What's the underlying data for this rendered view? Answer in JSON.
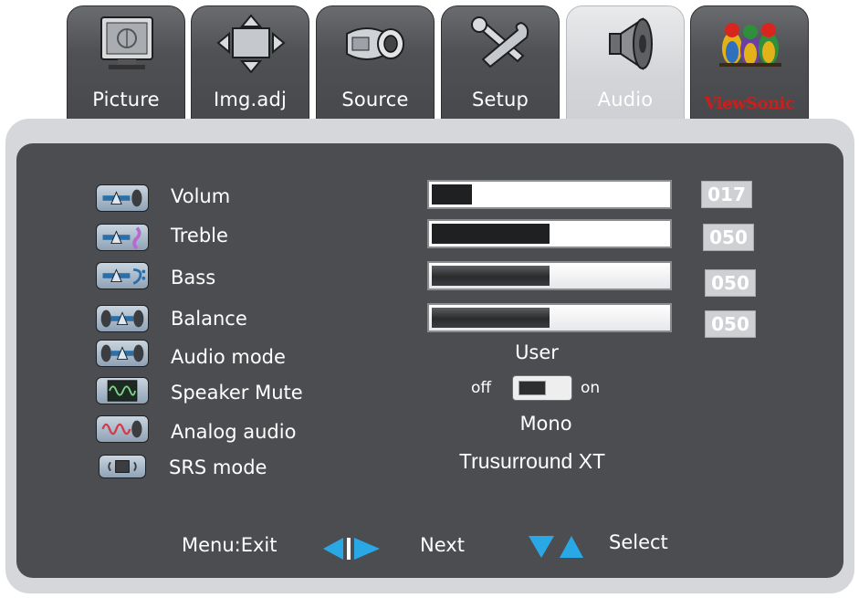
{
  "tabs": [
    {
      "label": "Picture",
      "icon": "monitor-icon"
    },
    {
      "label": "Img.adj",
      "icon": "arrows-move-icon"
    },
    {
      "label": "Source",
      "icon": "cable-plug-icon"
    },
    {
      "label": "Setup",
      "icon": "wrench-tools-icon"
    },
    {
      "label": "Audio",
      "icon": "speaker-icon",
      "active": true
    },
    {
      "label": "ViewSonic",
      "icon": "viewsonic-birds-logo"
    }
  ],
  "audio": {
    "volume": {
      "label": "Volum",
      "value": "017",
      "level": 0.17
    },
    "treble": {
      "label": "Treble",
      "value": "050",
      "level": 0.5
    },
    "bass": {
      "label": "Bass",
      "value": "050",
      "level": 0.5
    },
    "balance": {
      "label": "Balance",
      "value": "050",
      "level": 0.5
    },
    "audio_mode": {
      "label": "Audio mode",
      "value": "User"
    },
    "speaker_mute": {
      "label": "Speaker Mute",
      "off_label": "off",
      "on_label": "on",
      "state": "off"
    },
    "analog_audio": {
      "label": "Analog audio",
      "value": "Mono"
    },
    "srs_mode": {
      "label": "SRS mode",
      "value": "Trusurround XT"
    }
  },
  "footer": {
    "exit_label": "Menu:Exit",
    "next_label": "Next",
    "select_label": "Select"
  },
  "colors": {
    "panel_dark": "#4b4d50",
    "panel_light": "#d6d7da",
    "arrow_blue": "#2aa8e6",
    "brand_red": "#c9201e"
  }
}
